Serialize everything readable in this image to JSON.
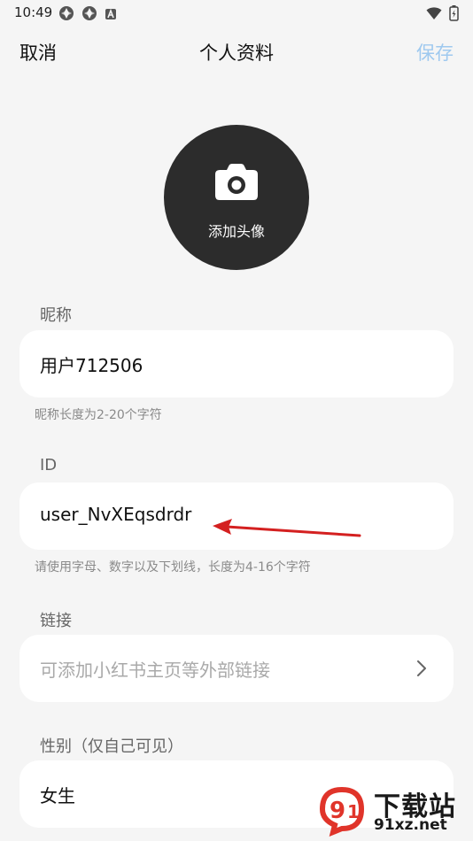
{
  "status_bar": {
    "time": "10:49"
  },
  "header": {
    "cancel_label": "取消",
    "title": "个人资料",
    "save_label": "保存"
  },
  "avatar": {
    "label": "添加头像"
  },
  "nickname": {
    "label": "昵称",
    "value": "用户712506",
    "hint": "昵称长度为2-20个字符"
  },
  "id_field": {
    "label": "ID",
    "value": "user_NvXEqsdrdr",
    "hint": "请使用字母、数字以及下划线，长度为4-16个字符"
  },
  "link": {
    "label": "链接",
    "placeholder": "可添加小红书主页等外部链接"
  },
  "gender": {
    "label": "性别（仅自己可见）",
    "value": "女生"
  },
  "watermark": {
    "title": "下载站",
    "url": "91xz.net"
  },
  "colors": {
    "background": "#f5f5f5",
    "avatar": "#2c2c2c",
    "save_disabled": "#9fc9ef",
    "arrow": "#d42020",
    "watermark_red": "#e0342a"
  }
}
